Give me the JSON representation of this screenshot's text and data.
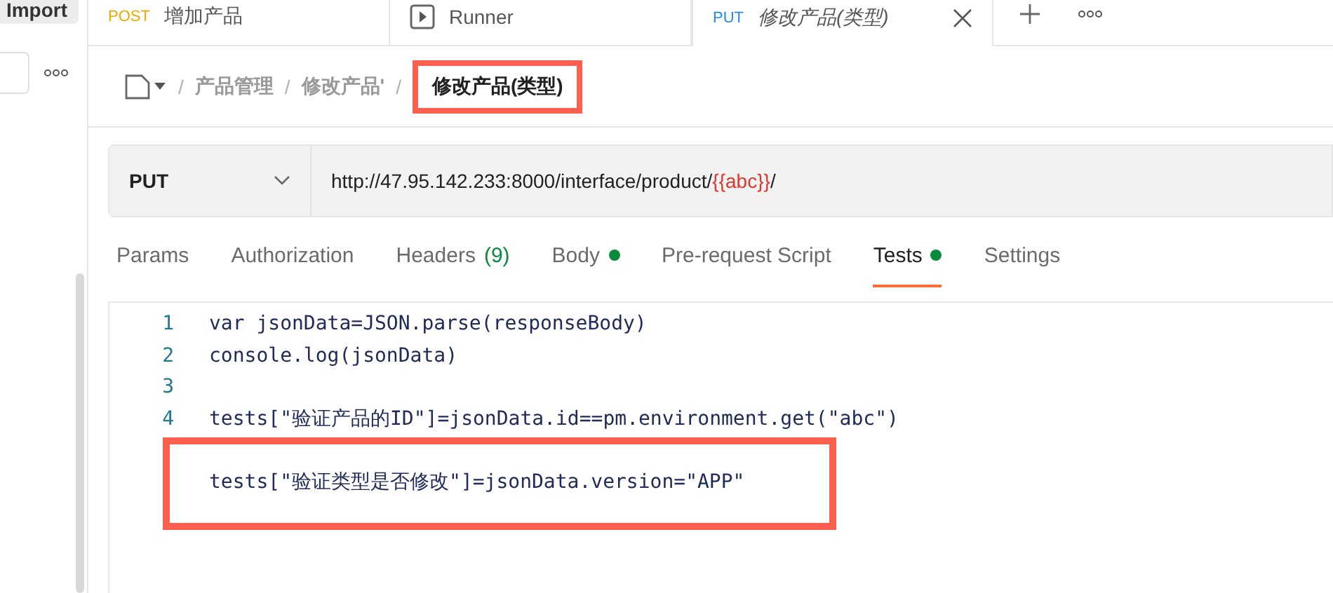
{
  "sidebar": {
    "import_button": "Import"
  },
  "tabs": [
    {
      "kind": "request",
      "method": "POST",
      "color": "#f0a800",
      "title": "增加产品",
      "selected": false,
      "unsaved": false
    },
    {
      "kind": "runner",
      "title": "Runner",
      "selected": false,
      "unsaved": false
    },
    {
      "kind": "request",
      "method": "PUT",
      "color": "#2a8ae0",
      "title": "修改产品(类型)",
      "selected": true,
      "unsaved": true
    }
  ],
  "breadcrumb": {
    "items": [
      {
        "kind": "separator",
        "text": "/"
      },
      {
        "kind": "folder",
        "text": "产品管理"
      },
      {
        "kind": "separator",
        "text": "/"
      },
      {
        "kind": "folder",
        "text": "修改产品'"
      },
      {
        "kind": "separator",
        "text": "/"
      }
    ],
    "current": "修改产品(类型)",
    "current_highlighted": true
  },
  "request": {
    "method": "PUT",
    "url_parts": [
      {
        "text": "http://47.95.142.233:8000/interface/product/",
        "kind": "plain"
      },
      {
        "text": "{{abc}}",
        "kind": "variable"
      },
      {
        "text": "/",
        "kind": "plain"
      }
    ]
  },
  "request_tabs": [
    {
      "label": "Params",
      "selected": false
    },
    {
      "label": "Authorization",
      "selected": false
    },
    {
      "label": "Headers",
      "count": "(9)",
      "selected": false
    },
    {
      "label": "Body",
      "dot": true,
      "selected": false
    },
    {
      "label": "Pre-request Script",
      "selected": false
    },
    {
      "label": "Tests",
      "dot": true,
      "selected": true
    },
    {
      "label": "Settings",
      "selected": false
    }
  ],
  "editor": {
    "lines": [
      {
        "kind": "code",
        "number": "1",
        "code": "var jsonData=JSON.parse(responseBody)"
      },
      {
        "kind": "code",
        "number": "2",
        "code": "console.log(jsonData)"
      },
      {
        "kind": "blank",
        "number": "3"
      },
      {
        "kind": "code",
        "number": "4",
        "code": "tests[\"验证产品的ID\"]=jsonData.id==pm.environment.get(\"abc\")"
      },
      {
        "kind": "blank"
      },
      {
        "kind": "code",
        "code": "tests[\"验证类型是否修改\"]=jsonData.version=\"APP\""
      }
    ]
  }
}
